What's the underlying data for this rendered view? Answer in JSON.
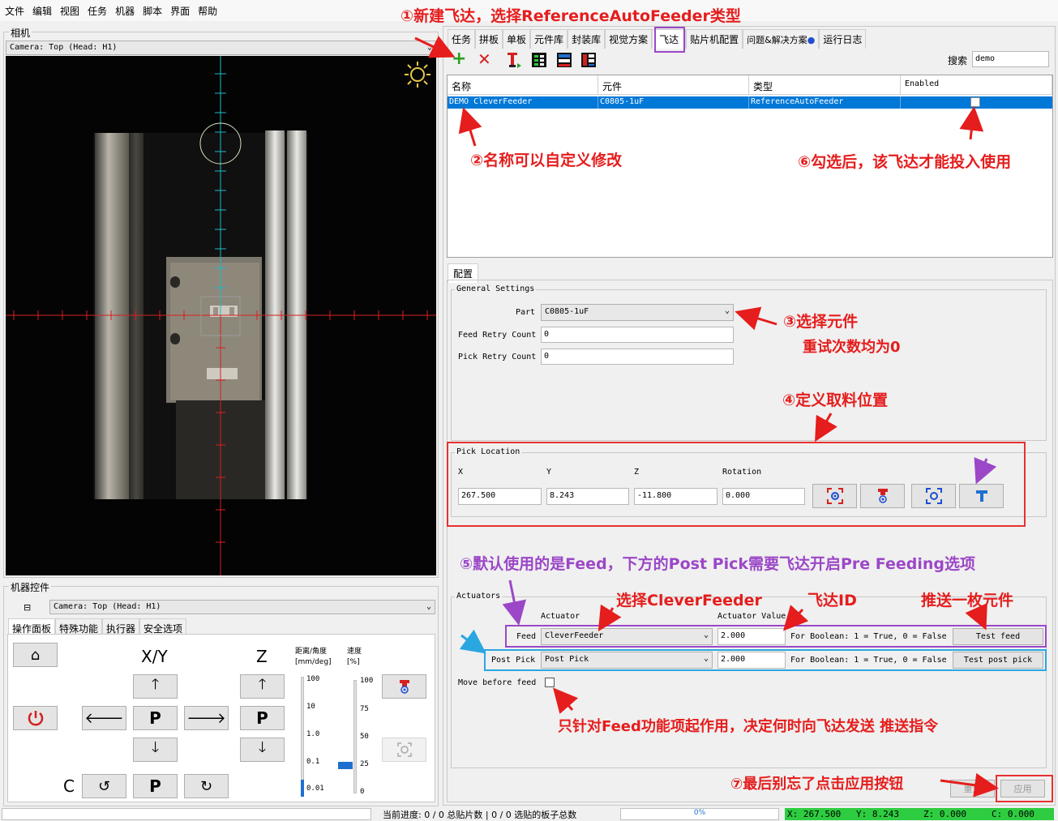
{
  "menu": [
    "文件",
    "编辑",
    "视图",
    "任务",
    "机器",
    "脚本",
    "界面",
    "帮助"
  ],
  "camera_panel": {
    "title": "相机",
    "selector": "Camera: Top (Head: H1)"
  },
  "machine_controls": {
    "title": "机器控件",
    "selector": "Camera: Top (Head: H1)",
    "tabs": [
      "操作面板",
      "特殊功能",
      "执行器",
      "安全选项"
    ],
    "xy_label": "X/Y",
    "z_label": "Z",
    "c_label": "C",
    "park_label": "P",
    "distance_label_1": "距离/角度",
    "distance_label_2": "[mm/deg]",
    "speed_label_1": "速度",
    "speed_label_2": "[%]",
    "distance_ticks": [
      "100",
      "10",
      "1.0",
      "0.1",
      "0.01"
    ],
    "speed_ticks": [
      "100",
      "75",
      "50",
      "25",
      "0"
    ],
    "speed_percent": 25,
    "distance_selected": "0.01"
  },
  "main_tabs": [
    "任务",
    "拼板",
    "单板",
    "元件库",
    "封装库",
    "视觉方案",
    "飞达",
    "贴片机配置",
    "问题&解决方案",
    "运行日志"
  ],
  "active_tab": "飞达",
  "search": {
    "label": "搜索",
    "value": "demo"
  },
  "table": {
    "headers": [
      "名称",
      "元件",
      "类型",
      "Enabled"
    ],
    "rows": [
      {
        "name": "DEMO CleverFeeder",
        "part": "C0805-1uF",
        "type": "ReferenceAutoFeeder",
        "enabled": false
      }
    ]
  },
  "config": {
    "tab": "配置",
    "general_title": "General Settings",
    "part_label": "Part",
    "part_value": "C0805-1uF",
    "feed_retry_label": "Feed Retry Count",
    "feed_retry_value": "0",
    "pick_retry_label": "Pick Retry Count",
    "pick_retry_value": "0",
    "pick_location_title": "Pick Location",
    "x_label": "X",
    "x_value": "267.500",
    "y_label": "Y",
    "y_value": "8.243",
    "z_label": "Z",
    "z_value": "-11.800",
    "rotation_label": "Rotation",
    "rotation_value": "0.000",
    "actuators_title": "Actuators",
    "actuator_col": "Actuator",
    "actuator_value_col": "Actuator Value",
    "feed_label": "Feed",
    "feed_actuator": "CleverFeeder",
    "feed_value": "2.000",
    "bool_hint": "For Boolean: 1 = True, 0 = False",
    "test_feed": "Test feed",
    "post_pick_label": "Post Pick",
    "post_pick_actuator": "Post Pick",
    "post_pick_value": "2.000",
    "test_post_pick": "Test post pick",
    "move_before_feed": "Move before feed",
    "reset": "重置",
    "apply": "应用"
  },
  "status": {
    "progress_label": "当前进度: 0 / 0 总贴片数 | 0 / 0 选贴的板子总数",
    "percent": "0%",
    "x": "X: 267.500",
    "y": "Y: 8.243",
    "z": "Z: 0.000",
    "c": "C: 0.000"
  },
  "annotations": {
    "a1": "①新建飞达，选择ReferenceAutoFeeder类型",
    "a2": "②名称可以自定义修改",
    "a3a": "③选择元件",
    "a3b": "重试次数均为0",
    "a4": "④定义取料位置",
    "a5": "⑤默认使用的是Feed，下方的Post Pick需要飞达开启Pre Feeding选项",
    "a6": "⑥勾选后，该飞达才能投入使用",
    "a7": "⑦最后别忘了点击应用按钮",
    "select_feeder": "选择CleverFeeder",
    "feeder_id": "飞达ID",
    "push_one": "推送一枚元件",
    "move_hint": "只针对Feed功能项起作用，决定何时向飞达发送 推送指令"
  },
  "colors": {
    "selection": "#0078d7",
    "annotation_red": "#e51d1d",
    "annotation_purple": "#9b47c7",
    "annotation_blue": "#2aa7e0",
    "crosshair_cyan": "#1fb8c8",
    "crosshair_red": "#d42020",
    "status_green": "#2ecc40"
  }
}
